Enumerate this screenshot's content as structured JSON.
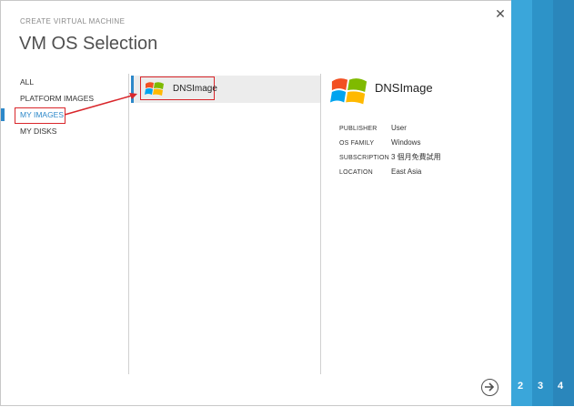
{
  "header": {
    "subtitle": "CREATE VIRTUAL MACHINE",
    "title": "VM OS Selection",
    "close_symbol": "✕"
  },
  "nav": {
    "items": [
      {
        "label": "ALL",
        "active": false
      },
      {
        "label": "PLATFORM IMAGES",
        "active": false
      },
      {
        "label": "MY IMAGES",
        "active": true
      },
      {
        "label": "MY DISKS",
        "active": false
      }
    ]
  },
  "images": {
    "items": [
      {
        "name": "DNSImage",
        "icon": "windows-logo-icon",
        "selected": true
      }
    ]
  },
  "detail": {
    "name": "DNSImage",
    "icon": "windows-logo-icon",
    "properties": [
      {
        "key": "PUBLISHER",
        "value": "User"
      },
      {
        "key": "OS FAMILY",
        "value": "Windows"
      },
      {
        "key": "SUBSCRIPTION",
        "value": "3 個月免費試用"
      },
      {
        "key": "LOCATION",
        "value": "East Asia"
      }
    ]
  },
  "steps": {
    "numbers": [
      "2",
      "3",
      "4"
    ]
  },
  "colors": {
    "accent": "#2d88c9",
    "step_band": "#36a0d4",
    "annotation_red": "#d9262b"
  }
}
